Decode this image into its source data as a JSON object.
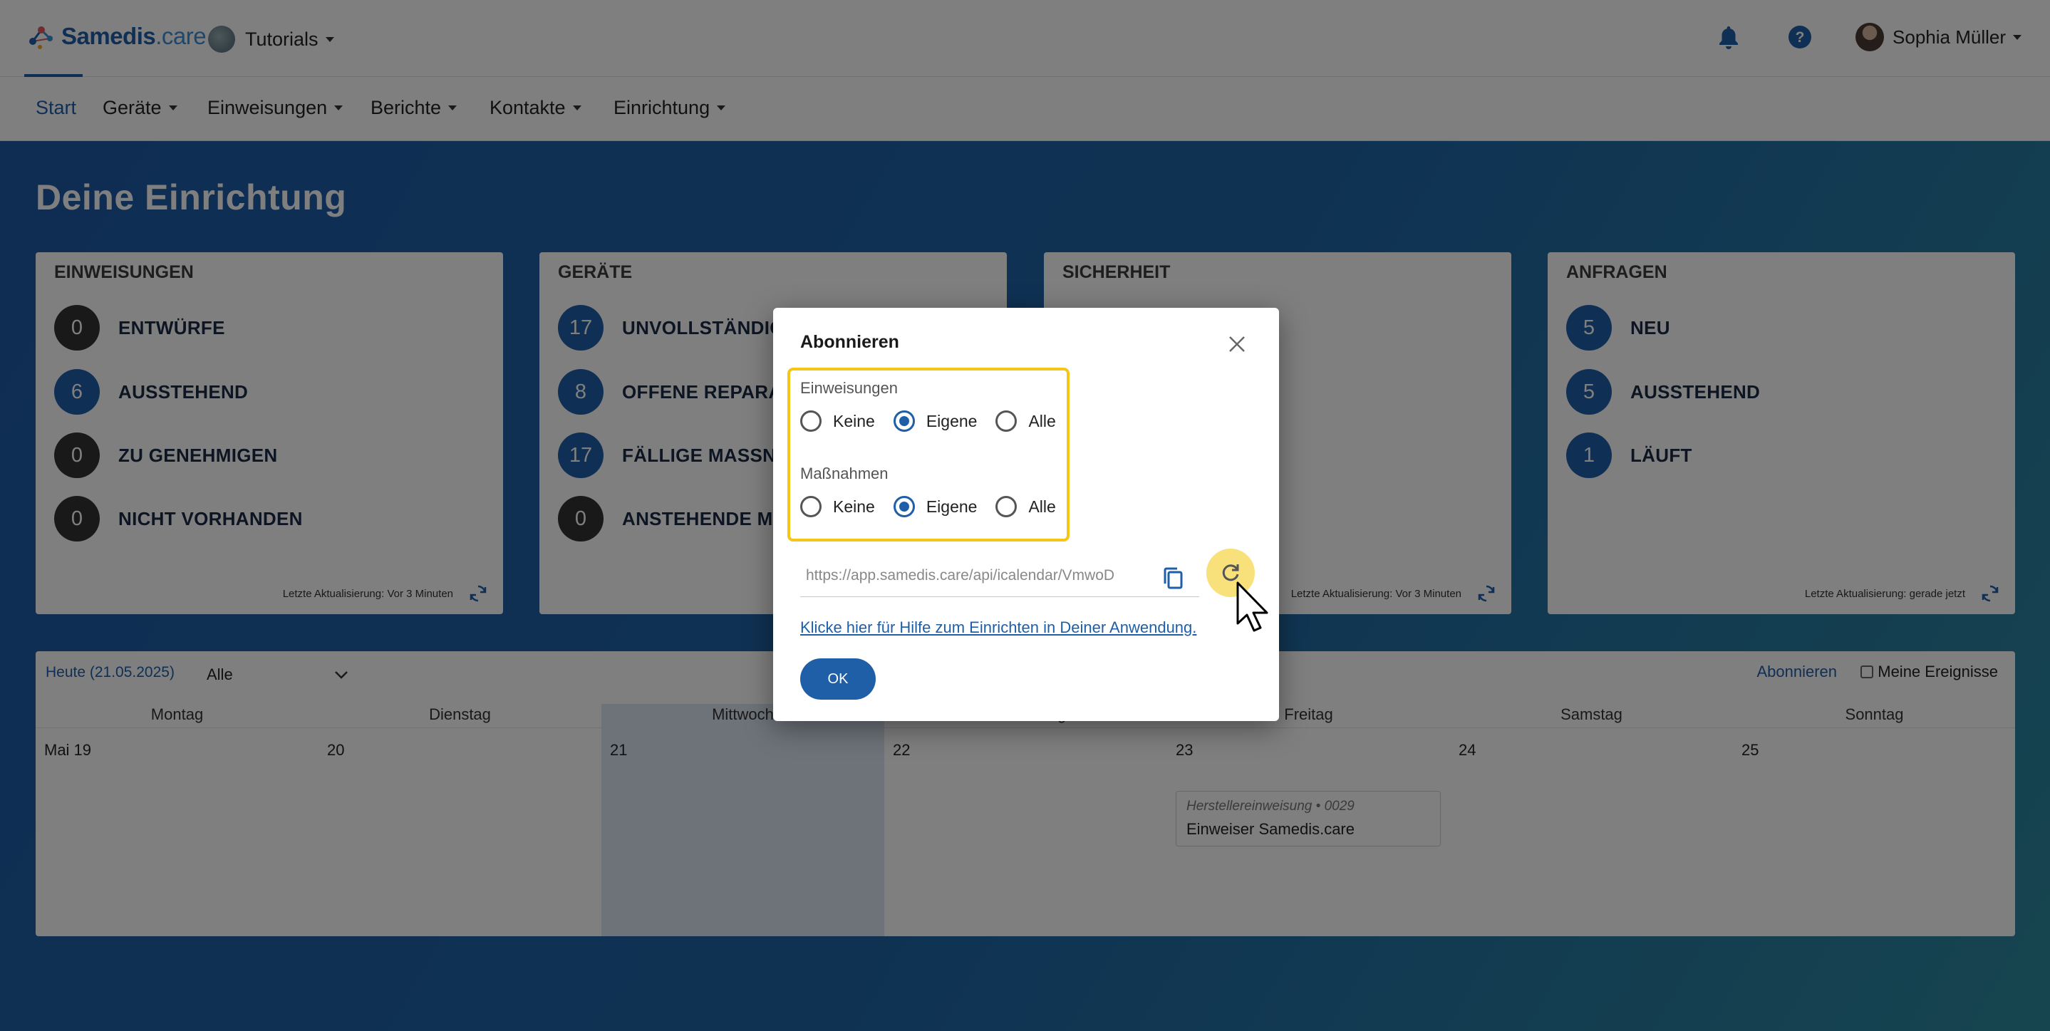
{
  "header": {
    "logo_text_a": "Samedis",
    "logo_text_b": ".care",
    "tenant": "Tutorials",
    "user": "Sophia Müller"
  },
  "nav": {
    "items": [
      "Start",
      "Geräte",
      "Einweisungen",
      "Berichte",
      "Kontakte",
      "Einrichtung"
    ],
    "active": "Start"
  },
  "page": {
    "title": "Deine Einrichtung"
  },
  "cards": [
    {
      "title": "EINWEISUNGEN",
      "stats": [
        {
          "count": "0",
          "label": "ENTWÜRFE",
          "style": "dark"
        },
        {
          "count": "6",
          "label": "AUSSTEHEND",
          "style": "blue"
        },
        {
          "count": "0",
          "label": "ZU GENEHMIGEN",
          "style": "dark"
        },
        {
          "count": "0",
          "label": "NICHT VORHANDEN",
          "style": "dark"
        }
      ],
      "footer": "Letzte Aktualisierung: Vor 3 Minuten"
    },
    {
      "title": "GERÄTE",
      "stats": [
        {
          "count": "17",
          "label": "UNVOLLSTÄNDIG",
          "style": "blue"
        },
        {
          "count": "8",
          "label": "OFFENE REPARATUREN",
          "style": "blue"
        },
        {
          "count": "17",
          "label": "FÄLLIGE MASSNAHMEN",
          "style": "blue"
        },
        {
          "count": "0",
          "label": "ANSTEHENDE MASSNAHMEN",
          "style": "dark"
        }
      ],
      "footer": ""
    },
    {
      "title": "SICHERHEIT",
      "stats": [],
      "footer": "Letzte Aktualisierung: Vor 3 Minuten"
    },
    {
      "title": "ANFRAGEN",
      "stats": [
        {
          "count": "5",
          "label": "NEU",
          "style": "blue"
        },
        {
          "count": "5",
          "label": "AUSSTEHEND",
          "style": "blue"
        },
        {
          "count": "1",
          "label": "LÄUFT",
          "style": "blue"
        }
      ],
      "footer": "Letzte Aktualisierung: gerade jetzt"
    }
  ],
  "calendar": {
    "today_label": "Heute (21.05.2025)",
    "filter_value": "Alle",
    "subscribe_label": "Abonnieren",
    "own_events_label": "Meine Ereignisse",
    "days": [
      "Montag",
      "Dienstag",
      "Mittwoch",
      "Donnerstag",
      "Freitag",
      "Samstag",
      "Sonntag"
    ],
    "dates": [
      "Mai 19",
      "20",
      "21",
      "22",
      "23",
      "24",
      "25"
    ],
    "today_index": 2,
    "event": {
      "meta": "Herstellereinweisung • 0029",
      "title": "Einweiser Samedis.care",
      "day_index": 4
    }
  },
  "dialog": {
    "title": "Abonnieren",
    "groups": [
      {
        "label": "Einweisungen",
        "options": [
          "Keine",
          "Eigene",
          "Alle"
        ],
        "selected": "Eigene"
      },
      {
        "label": "Maßnahmen",
        "options": [
          "Keine",
          "Eigene",
          "Alle"
        ],
        "selected": "Eigene"
      }
    ],
    "url": "https://app.samedis.care/api/icalendar/VmwoD",
    "help_link": "Klicke hier für Hilfe zum Einrichten in Deiner Anwendung.",
    "ok_label": "OK"
  },
  "colors": {
    "brand": "#1f5fa8",
    "highlight": "#f5c518",
    "dark_bubble": "#333333"
  }
}
